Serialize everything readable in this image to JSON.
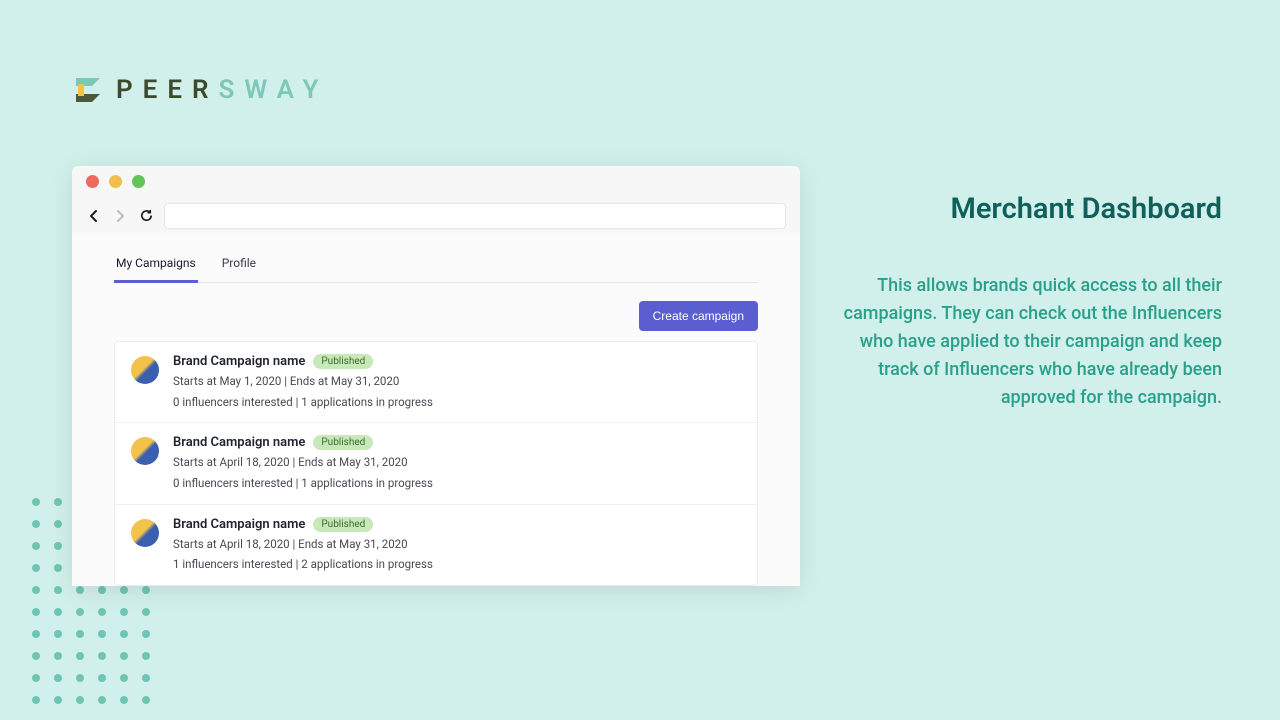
{
  "logo": {
    "text": "PEERSWAY"
  },
  "browser": {
    "tabs": [
      {
        "label": "My Campaigns",
        "active": true
      },
      {
        "label": "Profile",
        "active": false
      }
    ],
    "create_button": "Create campaign",
    "campaigns": [
      {
        "name": "Brand Campaign name",
        "status": "Published",
        "dates": "Starts at May 1, 2020 | Ends at May 31, 2020",
        "stats": "0 influencers interested | 1 applications in progress"
      },
      {
        "name": "Brand Campaign name",
        "status": "Published",
        "dates": "Starts at April 18, 2020 | Ends at May 31, 2020",
        "stats": "0 influencers interested | 1 applications in progress"
      },
      {
        "name": "Brand Campaign name",
        "status": "Published",
        "dates": "Starts at April 18, 2020 | Ends at May 31, 2020",
        "stats": "1 influencers interested | 2 applications in progress"
      }
    ]
  },
  "copy": {
    "title": "Merchant Dashboard",
    "body": "This allows brands quick access to all their campaigns. They can check out the Influencers who have applied to their campaign and keep track of Influencers who have already been approved for the campaign."
  }
}
